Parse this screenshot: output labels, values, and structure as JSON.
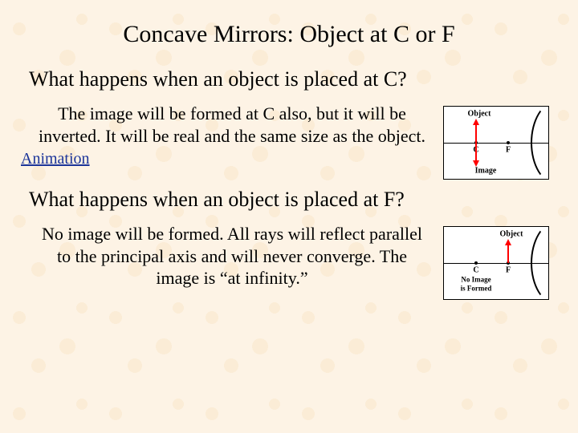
{
  "title": "Concave Mirrors: Object at C or F",
  "section1": {
    "heading": "What happens when an object is placed at C?",
    "body": "The image will be formed at C also, but it will be inverted. It will be real and the same size as the object.",
    "link": "Animation",
    "diagram": {
      "object_label": "Object",
      "image_label": "Image",
      "c_label": "C",
      "f_label": "F"
    }
  },
  "section2": {
    "heading": "What happens when an object is placed at F?",
    "body": "No image will be formed. All rays will reflect parallel to the principal axis and will never converge. The image is “at infinity.”",
    "diagram": {
      "object_label": "Object",
      "no_image_line1": "No Image",
      "no_image_line2": "is Formed",
      "c_label": "C",
      "f_label": "F"
    }
  }
}
